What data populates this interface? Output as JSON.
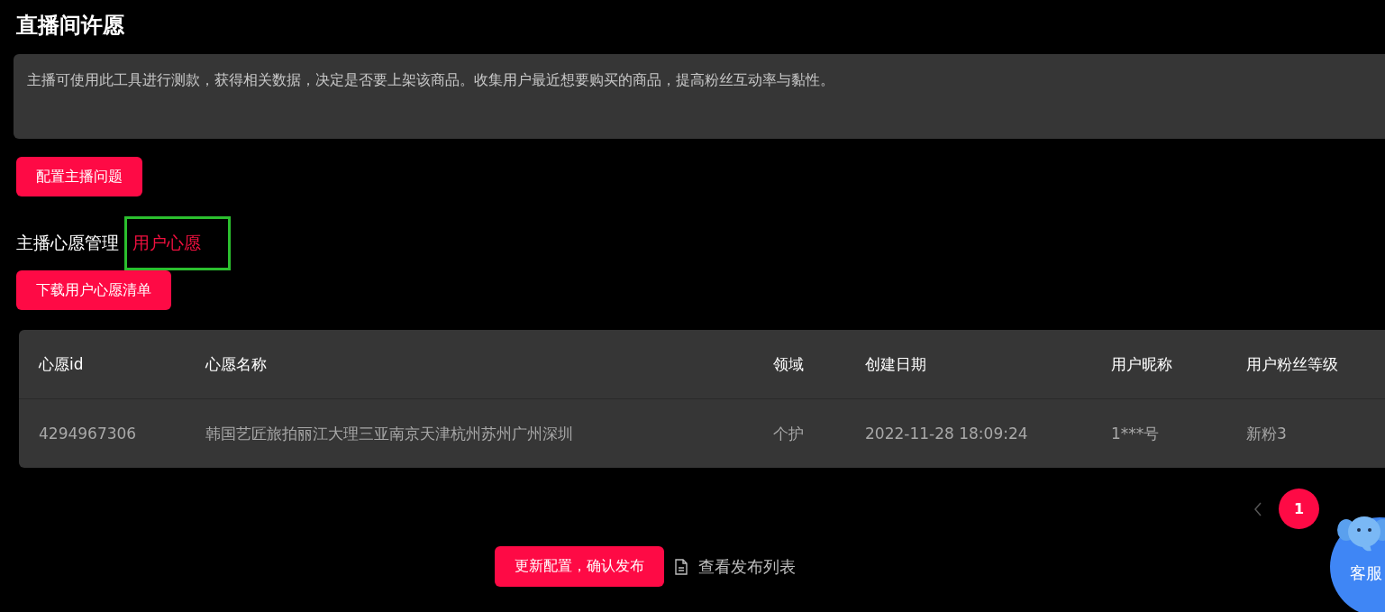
{
  "title": "直播间许愿",
  "description": "主播可使用此工具进行测款，获得相关数据，决定是否要上架该商品。收集用户最近想要购买的商品，提高粉丝互动率与黏性。",
  "config_button": "配置主播问题",
  "tabs": [
    {
      "label": "主播心愿管理",
      "selected": false
    },
    {
      "label": "用户心愿",
      "selected": true
    }
  ],
  "download_button": "下载用户心愿清单",
  "table": {
    "columns": [
      "心愿id",
      "心愿名称",
      "领域",
      "创建日期",
      "用户昵称",
      "用户粉丝等级"
    ],
    "rows": [
      [
        "4294967306",
        "韩国艺匠旅拍丽江大理三亚南京天津杭州苏州广州深圳",
        "个护",
        "2022-11-28 18:09:24",
        "1***号",
        "新粉3"
      ]
    ]
  },
  "pagination": {
    "pages": [
      {
        "label": "1",
        "selected": true
      }
    ]
  },
  "publish_button": "更新配置，确认发布",
  "publish_list_link": "查看发布列表",
  "support": {
    "label": "客服"
  }
}
